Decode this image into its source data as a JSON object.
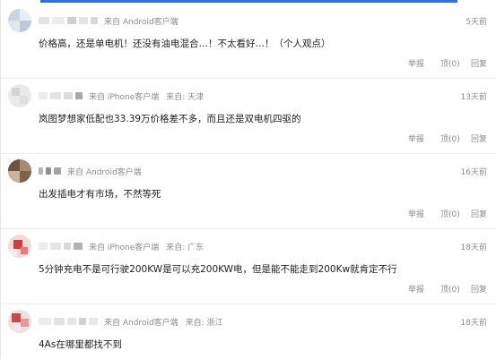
{
  "comments": [
    {
      "source": "来自 Android客户端",
      "location": "",
      "time": "5天前",
      "content": "价格高，还是单电机！还没有油电混合…！不太看好…！（个人观点）",
      "report": "举报",
      "like": "顶(0)",
      "reply": "回复"
    },
    {
      "source": "来自 iPhone客户端",
      "location": "来自: 天津",
      "time": "13天前",
      "content": "岚图梦想家低配也33.39万价格差不多，而且还是双电机四驱的",
      "report": "举报",
      "like": "顶(0)",
      "reply": "回复"
    },
    {
      "source": "来自 Android客户端",
      "location": "",
      "time": "16天前",
      "content": "出发插电才有市场，不然等死",
      "report": "举报",
      "like": "顶(0)",
      "reply": "回复"
    },
    {
      "source": "来自 iPhone客户端",
      "location": "来自: 广东",
      "time": "18天前",
      "content": "5分钟充电不是可行驶200KW是可以充200KW电，但是能不能走到200Kw就肯定不行",
      "report": "举报",
      "like": "顶(0)",
      "reply": "回复"
    },
    {
      "source": "来自 Android客户端",
      "location": "来自: 浙江",
      "time": "18天前",
      "content": "4As在哪里都找不到",
      "report": "",
      "like": "",
      "reply": ""
    }
  ],
  "colors": {
    "accent": "#2f6fe0",
    "meta_text": "#8c8c8c",
    "content_text": "#222222",
    "divider": "#eeeeee"
  }
}
